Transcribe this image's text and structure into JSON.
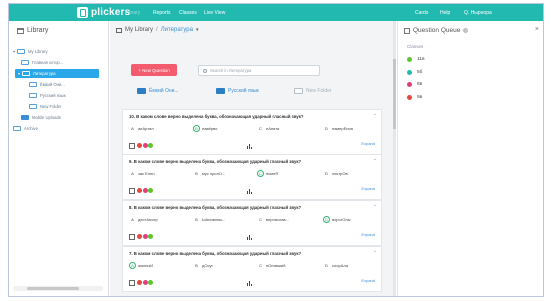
{
  "topbar": {
    "brand": "plickers",
    "nav": [
      "Library",
      "Reports",
      "Classes",
      "Live View"
    ],
    "right": [
      "Cards",
      "Help",
      "Q. Нырнора"
    ]
  },
  "sidebar": {
    "title": "Library",
    "items": [
      {
        "label": "My Library"
      },
      {
        "label": "Главная котор..."
      },
      {
        "label": "Литература"
      },
      {
        "label": "Ёмкий Они..."
      },
      {
        "label": "Русский язык"
      },
      {
        "label": "New Folder"
      },
      {
        "label": "Mobile Uploads"
      },
      {
        "label": "Archive"
      }
    ]
  },
  "main": {
    "breadcrumb": {
      "root": "My Library",
      "sep": "/",
      "current": "Литература"
    },
    "new_question": "+ New Question",
    "search_placeholder": "Search in Литература",
    "folders": [
      "Ёмкий Они...",
      "Русский язык",
      "New Folder"
    ],
    "expand_label": "Expand",
    "questions": [
      {
        "text": "10. В каком слове верно выделена буква, обозначающая ударный гласный звук?",
        "answers": [
          {
            "letter": "A",
            "text": "аеАртал"
          },
          {
            "letter": "B",
            "text": "еавёрво"
          },
          {
            "letter": "C",
            "text": "еАнята"
          },
          {
            "letter": "D",
            "text": "намерЕния"
          }
        ],
        "correct": 1
      },
      {
        "text": "9. В каком слове верно выделена буква, обозначающая ударный гласный звук?",
        "answers": [
          {
            "letter": "A",
            "text": "зас Елен"
          },
          {
            "letter": "B",
            "text": "мус оролО..."
          },
          {
            "letter": "C",
            "text": "ньмнЯ"
          },
          {
            "letter": "D",
            "text": "лектрОв"
          }
        ],
        "correct": 2
      },
      {
        "text": "8. В каком слове верно выделена буква, обозначающая ударный гласный звук?",
        "answers": [
          {
            "letter": "A",
            "text": "дестАнсер"
          },
          {
            "letter": "B",
            "text": "ЫАповоны..."
          },
          {
            "letter": "C",
            "text": "вернислав..."
          },
          {
            "letter": "D",
            "text": "ворогОлы"
          }
        ],
        "correct": 3
      },
      {
        "text": "7. В каком слове верно выделена буква, обозначающая ударный гласный звук?",
        "answers": [
          {
            "letter": "A",
            "text": "жалюзИ"
          },
          {
            "letter": "B",
            "text": "дОсуг"
          },
          {
            "letter": "C",
            "text": "пОнявший"
          },
          {
            "letter": "D",
            "text": "соорАла"
          }
        ],
        "correct": 0
      }
    ]
  },
  "queue": {
    "title": "Question Queue",
    "help": "?",
    "close": "×",
    "classes_label": "Classes",
    "classes": [
      {
        "name": "11в",
        "color": "#5cc431"
      },
      {
        "name": "5б",
        "color": "#22b9b0"
      },
      {
        "name": "8в",
        "color": "#e23e7b"
      },
      {
        "name": "9в",
        "color": "#e8473e"
      }
    ]
  },
  "dot_colors": [
    "#e8473e",
    "#e23e7b",
    "#5cc431"
  ]
}
